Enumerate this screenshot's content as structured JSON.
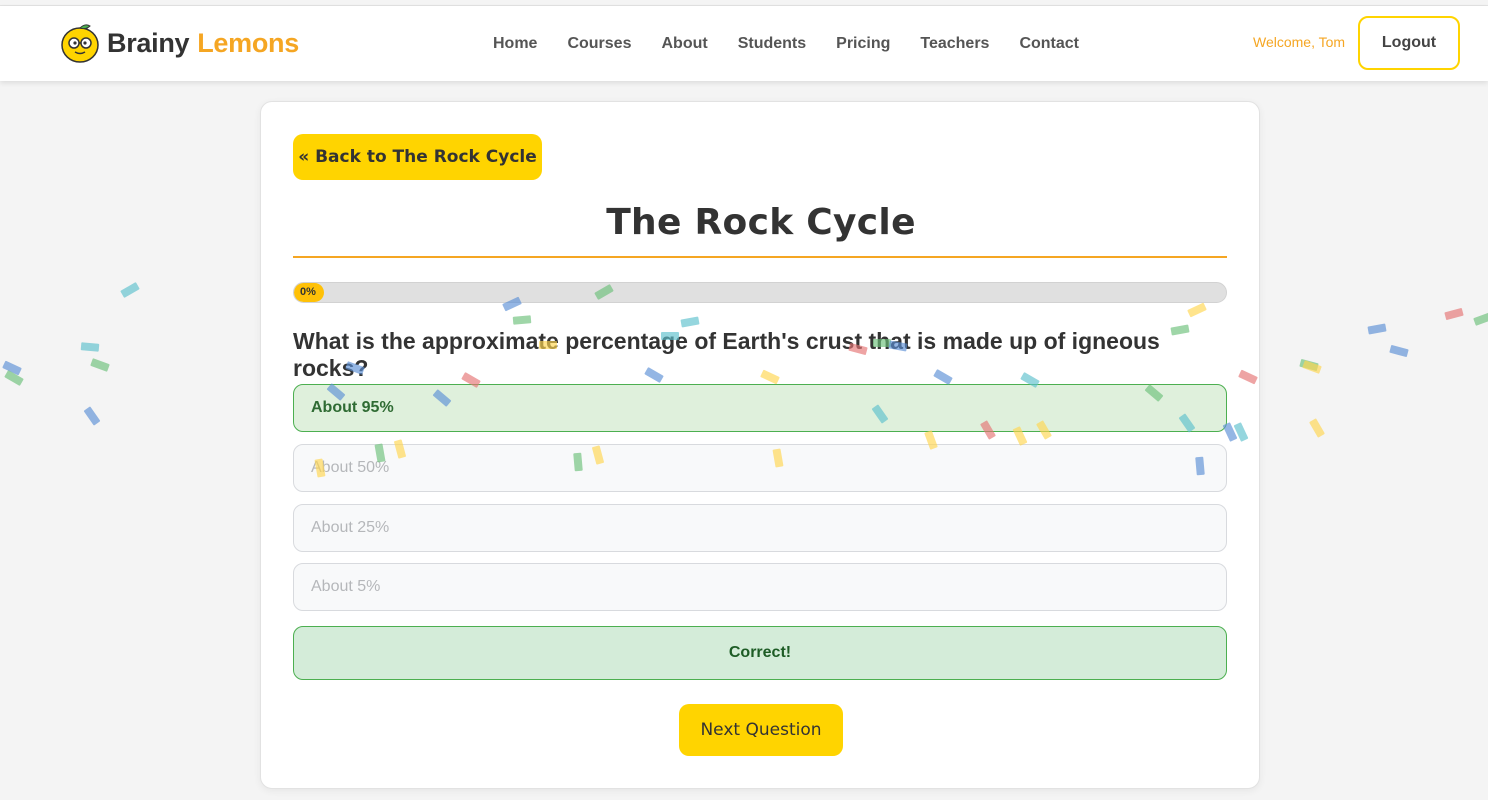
{
  "navbar": {
    "brand_part1": "Brainy",
    "brand_part2": "Lemons",
    "links": [
      "Home",
      "Courses",
      "About",
      "Students",
      "Pricing",
      "Teachers",
      "Contact"
    ],
    "welcome": "Welcome, Tom",
    "logout_label": "Logout"
  },
  "quiz": {
    "back_label": "« Back to The Rock Cycle",
    "title": "The Rock Cycle",
    "progress_percent": 0,
    "progress_label": "0%",
    "question": "What is the approximate percentage of Earth's crust that is made up of igneous rocks?",
    "options": [
      "About 95%",
      "About 50%",
      "About 25%",
      "About 5%"
    ],
    "selected_option": "About 95%",
    "feedback": "Correct!",
    "next_label": "Next Question"
  },
  "colors": {
    "accent_yellow": "#ffd400",
    "accent_orange": "#f5a623",
    "correct_green": "#4caf50",
    "confetti": [
      "#5b8fd6",
      "#5cc0cc",
      "#6cc07a",
      "#ffd54f",
      "#e57373"
    ]
  }
}
